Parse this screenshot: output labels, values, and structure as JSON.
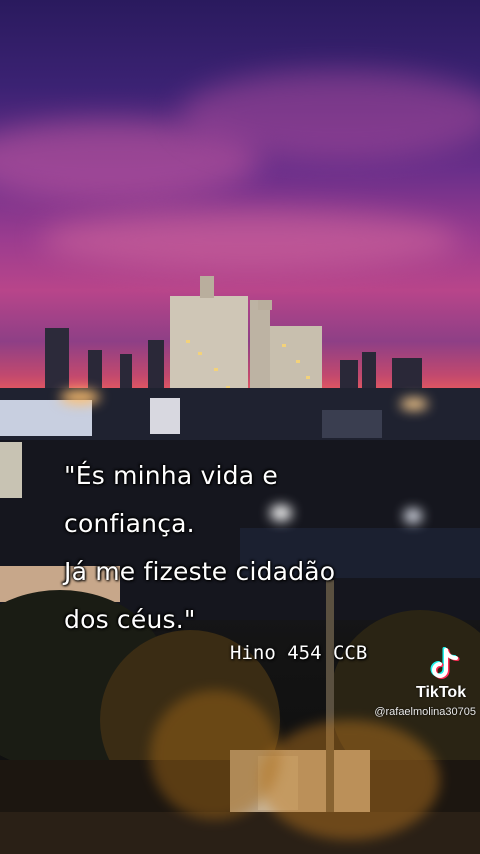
{
  "quote": {
    "lines": [
      "\"És minha vida e",
      "confiança.",
      "Já me fizeste cidadão",
      "dos céus.\""
    ]
  },
  "credit": "Hino 454 CCB",
  "watermark": {
    "brand": "TikTok",
    "username": "@rafaelmolina30705",
    "logo_icon": "tiktok-note-icon"
  },
  "colors": {
    "sky_top": "#2a1a5e",
    "sky_pink": "#b8458a",
    "horizon": "#e85a5e",
    "text": "#ffffff"
  }
}
